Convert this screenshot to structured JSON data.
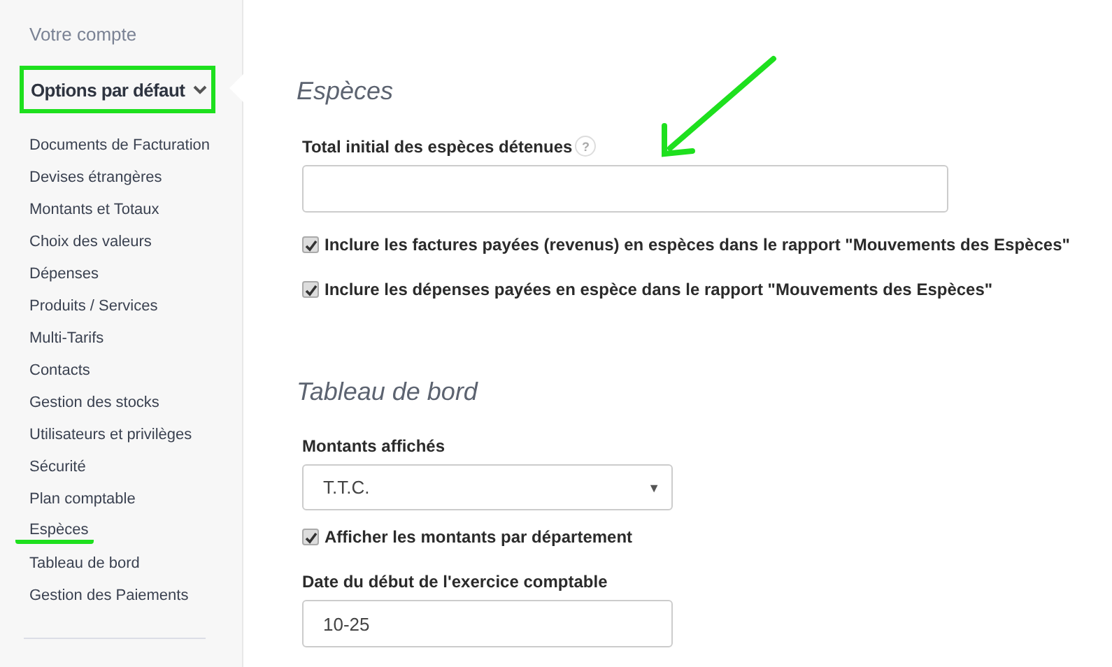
{
  "sidebar": {
    "account_link": "Votre compte",
    "group": {
      "label": "Options par défaut",
      "expanded": true,
      "highlighted": true
    },
    "items": [
      {
        "label": "Documents de Facturation",
        "selected": false
      },
      {
        "label": "Devises étrangères",
        "selected": false
      },
      {
        "label": "Montants et Totaux",
        "selected": false
      },
      {
        "label": "Choix des valeurs",
        "selected": false
      },
      {
        "label": "Dépenses",
        "selected": false
      },
      {
        "label": "Produits / Services",
        "selected": false
      },
      {
        "label": "Multi-Tarifs",
        "selected": false
      },
      {
        "label": "Contacts",
        "selected": false
      },
      {
        "label": "Gestion des stocks",
        "selected": false
      },
      {
        "label": "Utilisateurs et privilèges",
        "selected": false
      },
      {
        "label": "Sécurité",
        "selected": false
      },
      {
        "label": "Plan comptable",
        "selected": false
      },
      {
        "label": "Espèces",
        "selected": true
      },
      {
        "label": "Tableau de bord",
        "selected": false
      },
      {
        "label": "Gestion des Paiements",
        "selected": false
      }
    ]
  },
  "sections": [
    {
      "title": "Espèces",
      "fields": [
        {
          "kind": "text",
          "label": "Total initial des espèces détenues",
          "help": "?"
        },
        {
          "kind": "checkbox",
          "label": "Inclure les factures payées (revenus) en espèces dans le rapport \"Mouvements des Espèces\"",
          "checked": true
        },
        {
          "kind": "checkbox",
          "label": "Inclure les dépenses payées en espèce dans le rapport \"Mouvements des Espèces\"",
          "checked": true
        }
      ]
    },
    {
      "title": "Tableau de bord",
      "fields": [
        {
          "kind": "select",
          "label": "Montants affichés",
          "value": "T.T.C.",
          "arrow": "▼"
        },
        {
          "kind": "checkbox",
          "label": "Afficher les montants par département",
          "checked": true
        },
        {
          "kind": "text",
          "label": "Date du début de l'exercice comptable",
          "value": "10-25"
        }
      ]
    }
  ]
}
